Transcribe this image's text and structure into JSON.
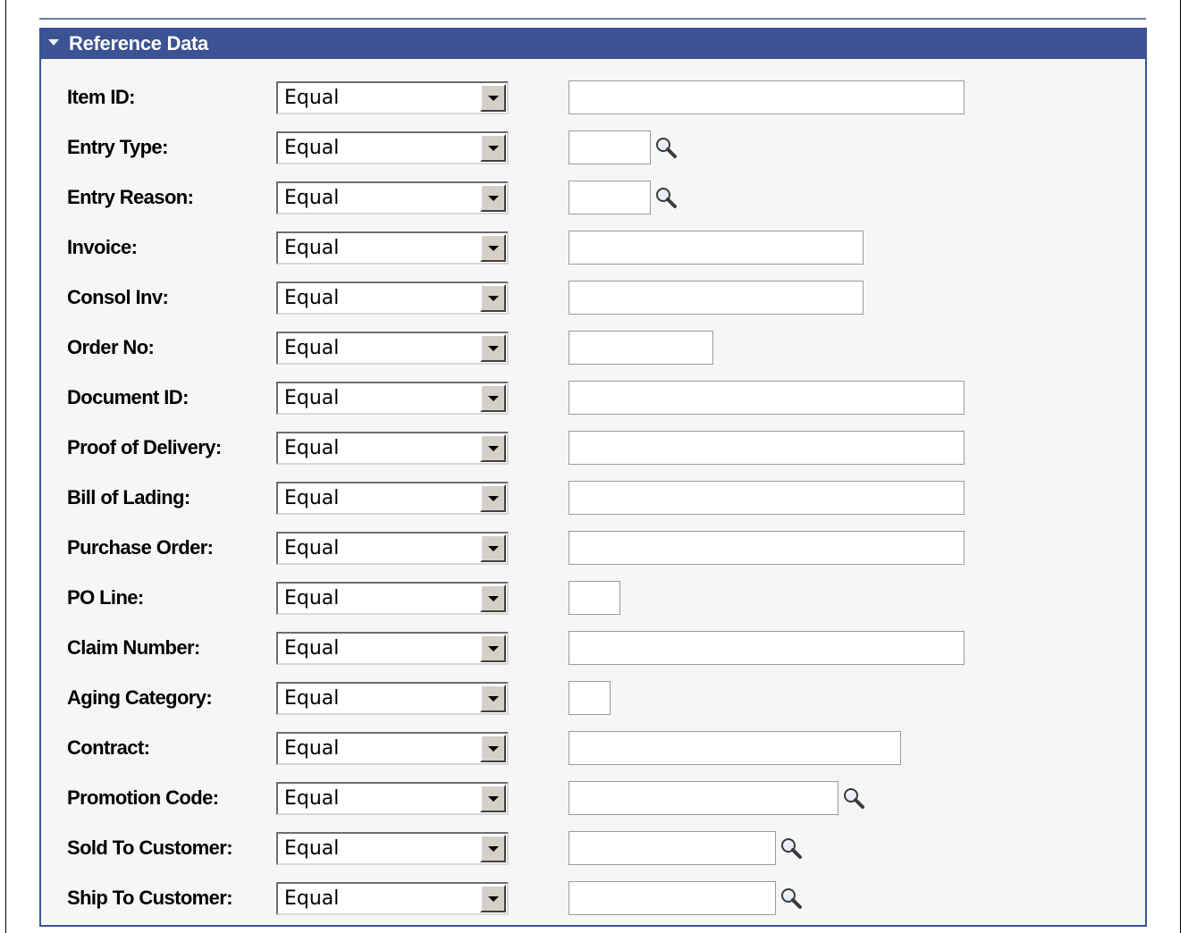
{
  "section": {
    "title": "Reference Data",
    "collapse_icon": "triangle-down-icon"
  },
  "operator_options": [
    "Equal"
  ],
  "fields": [
    {
      "label": "Item ID:",
      "operator": "Equal",
      "value": "",
      "lookup": false
    },
    {
      "label": "Entry Type:",
      "operator": "Equal",
      "value": "",
      "lookup": true
    },
    {
      "label": "Entry Reason:",
      "operator": "Equal",
      "value": "",
      "lookup": true
    },
    {
      "label": "Invoice:",
      "operator": "Equal",
      "value": "",
      "lookup": false
    },
    {
      "label": "Consol Inv:",
      "operator": "Equal",
      "value": "",
      "lookup": false
    },
    {
      "label": "Order No:",
      "operator": "Equal",
      "value": "",
      "lookup": false
    },
    {
      "label": "Document ID:",
      "operator": "Equal",
      "value": "",
      "lookup": false
    },
    {
      "label": "Proof of Delivery:",
      "operator": "Equal",
      "value": "",
      "lookup": false
    },
    {
      "label": "Bill of Lading:",
      "operator": "Equal",
      "value": "",
      "lookup": false
    },
    {
      "label": "Purchase Order:",
      "operator": "Equal",
      "value": "",
      "lookup": false
    },
    {
      "label": "PO Line:",
      "operator": "Equal",
      "value": "",
      "lookup": false
    },
    {
      "label": "Claim Number:",
      "operator": "Equal",
      "value": "",
      "lookup": false
    },
    {
      "label": "Aging Category:",
      "operator": "Equal",
      "value": "",
      "lookup": false
    },
    {
      "label": "Contract:",
      "operator": "Equal",
      "value": "",
      "lookup": false
    },
    {
      "label": "Promotion Code:",
      "operator": "Equal",
      "value": "",
      "lookup": true
    },
    {
      "label": "Sold To Customer:",
      "operator": "Equal",
      "value": "",
      "lookup": true
    },
    {
      "label": "Ship To Customer:",
      "operator": "Equal",
      "value": "",
      "lookup": true
    }
  ],
  "icons": {
    "dropdown": "chevron-down-icon",
    "lookup": "magnifier-icon"
  },
  "colors": {
    "header_bg": "#3b5293",
    "header_text": "#ffffff",
    "panel_bg": "#f6f6f6",
    "border": "#3d5593"
  }
}
